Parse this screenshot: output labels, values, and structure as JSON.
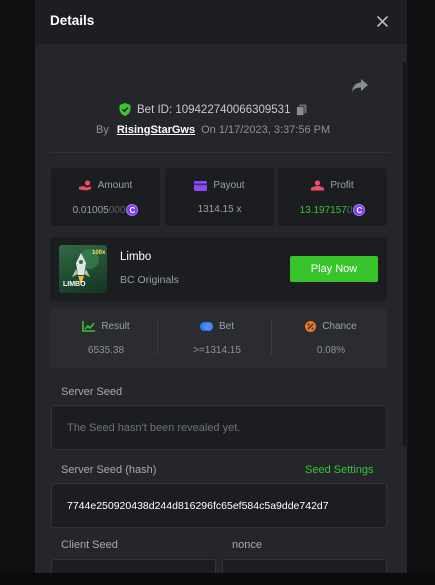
{
  "modal": {
    "title": "Details"
  },
  "bet": {
    "id_label": "Bet ID: 109422740066309531",
    "by_label": "By",
    "user": "RisingStarGws",
    "date": "On 1/17/2023, 3:37:56 PM"
  },
  "stats": {
    "amount": {
      "label": "Amount",
      "value_main": "0.01005",
      "value_dim": "000"
    },
    "payout": {
      "label": "Payout",
      "value": "1314.15 x"
    },
    "profit": {
      "label": "Profit",
      "value_main": "13.197157",
      "value_dim": "0"
    }
  },
  "coin_glyph": "C",
  "game": {
    "thumb_text": "LIMBO",
    "thumb_badge": "100x",
    "name": "Limbo",
    "provider": "BC Originals",
    "play_label": "Play Now"
  },
  "result": {
    "result_label": "Result",
    "result_value": "6535.38",
    "bet_label": "Bet",
    "bet_value": ">=1314.15",
    "chance_label": "Chance",
    "chance_value": "0.08%"
  },
  "server_seed": {
    "label": "Server Seed",
    "value": "The Seed hasn't been revealed yet."
  },
  "server_seed_hash": {
    "label": "Server Seed (hash)",
    "settings_label": "Seed Settings",
    "value": "7744e250920438d244d816296fc65ef584c5a9dde742d7"
  },
  "client_seed": {
    "label": "Client Seed"
  },
  "nonce": {
    "label": "nonce"
  },
  "colors": {
    "accent_green": "#38c42b",
    "coin_purple": "#7b3cf2",
    "panel": "#24262b"
  },
  "icons": {
    "close": "close-icon",
    "share": "share-icon",
    "shield": "shield-check-icon",
    "copy": "copy-icon",
    "amount": "coins-hand-icon",
    "payout": "card-icon",
    "profit": "profit-icon",
    "result": "chart-icon",
    "bet": "bet-icon",
    "chance": "percent-icon"
  }
}
